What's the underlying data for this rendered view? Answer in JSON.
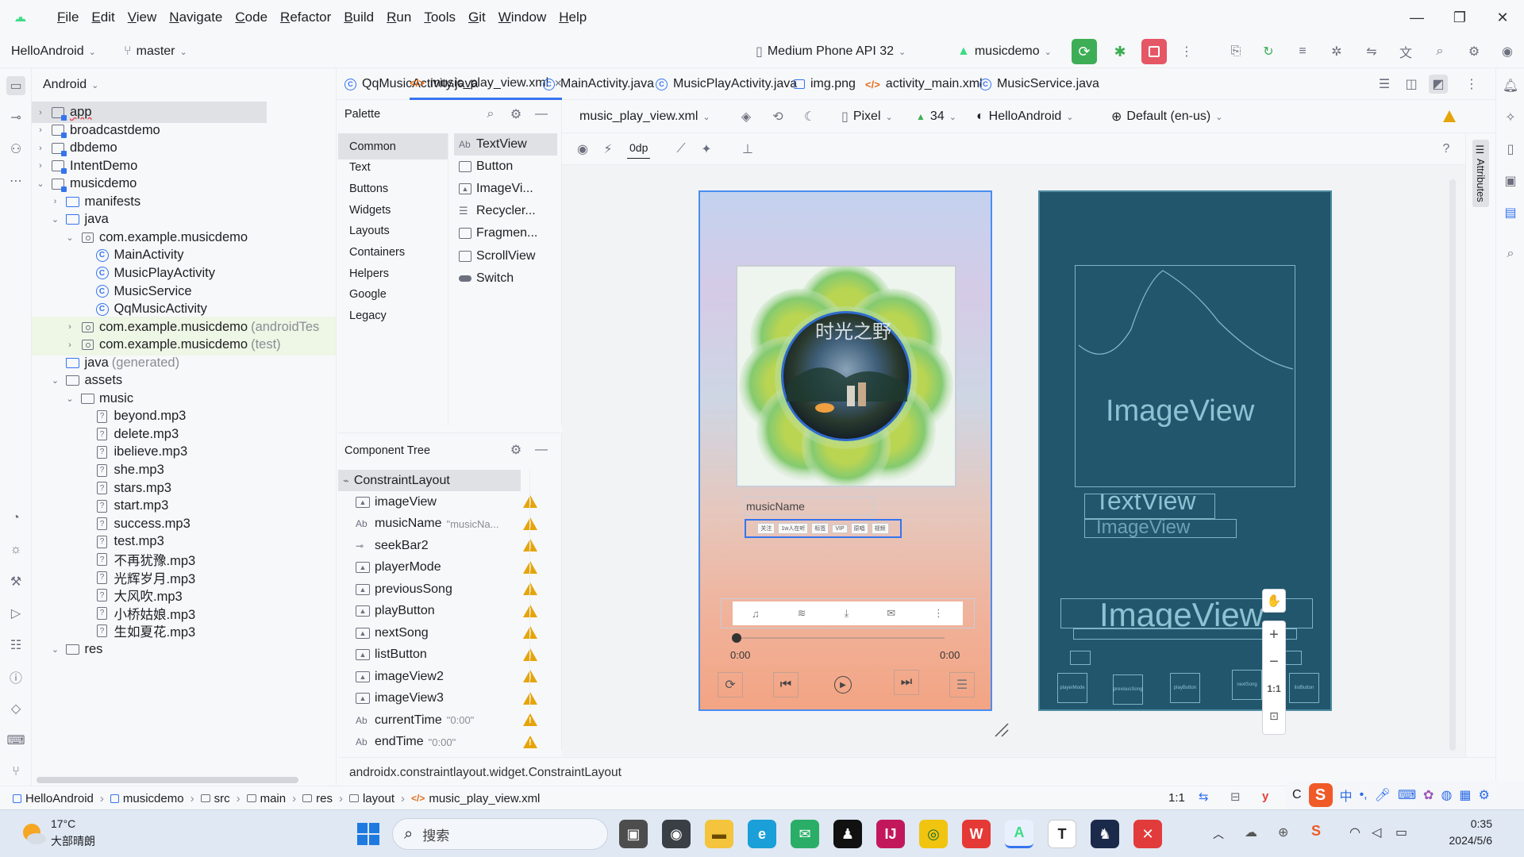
{
  "menu": {
    "items": [
      "File",
      "Edit",
      "View",
      "Navigate",
      "Code",
      "Refactor",
      "Build",
      "Run",
      "Tools",
      "Git",
      "Window",
      "Help"
    ],
    "mnemonics": [
      "F",
      "E",
      "V",
      "N",
      "C",
      "R",
      "B",
      "R",
      "T",
      "G",
      "W",
      "H"
    ]
  },
  "toolbar": {
    "project": "HelloAndroid",
    "branch": "master",
    "device": "Medium Phone API 32",
    "run_config": "musicdemo"
  },
  "project_panel": {
    "view_label": "Android",
    "rows": [
      {
        "label": "app",
        "icon": "module",
        "indent": 0,
        "arrow": "›",
        "underline": true
      },
      {
        "label": "broadcastdemo",
        "icon": "module",
        "indent": 0,
        "arrow": "›"
      },
      {
        "label": "dbdemo",
        "icon": "module",
        "indent": 0,
        "arrow": "›"
      },
      {
        "label": "IntentDemo",
        "icon": "module",
        "indent": 0,
        "arrow": "›"
      },
      {
        "label": "musicdemo",
        "icon": "module",
        "indent": 0,
        "arrow": "⌄"
      },
      {
        "label": "manifests",
        "icon": "folder-blue",
        "indent": 1,
        "arrow": "›"
      },
      {
        "label": "java",
        "icon": "folder-blue",
        "indent": 1,
        "arrow": "⌄"
      },
      {
        "label": "com.example.musicdemo",
        "icon": "package",
        "indent": 2,
        "arrow": "⌄"
      },
      {
        "label": "MainActivity",
        "icon": "class",
        "indent": 3,
        "arrow": ""
      },
      {
        "label": "MusicPlayActivity",
        "icon": "class",
        "indent": 3,
        "arrow": ""
      },
      {
        "label": "MusicService",
        "icon": "class",
        "indent": 3,
        "arrow": ""
      },
      {
        "label": "QqMusicActivity",
        "icon": "class",
        "indent": 3,
        "arrow": ""
      },
      {
        "label": "com.example.musicdemo",
        "icon": "package",
        "indent": 2,
        "arrow": "›",
        "suffix": "(androidTes",
        "green": true
      },
      {
        "label": "com.example.musicdemo",
        "icon": "package",
        "indent": 2,
        "arrow": "›",
        "suffix": "(test)",
        "green": true
      },
      {
        "label": "java",
        "icon": "folder-blue",
        "indent": 1,
        "arrow": "",
        "suffix": "(generated)"
      },
      {
        "label": "assets",
        "icon": "folder",
        "indent": 1,
        "arrow": "⌄"
      },
      {
        "label": "music",
        "icon": "folder",
        "indent": 2,
        "arrow": "⌄"
      },
      {
        "label": "beyond.mp3",
        "icon": "file",
        "indent": 3,
        "arrow": ""
      },
      {
        "label": "delete.mp3",
        "icon": "file",
        "indent": 3,
        "arrow": ""
      },
      {
        "label": "ibelieve.mp3",
        "icon": "file",
        "indent": 3,
        "arrow": ""
      },
      {
        "label": "she.mp3",
        "icon": "file",
        "indent": 3,
        "arrow": ""
      },
      {
        "label": "stars.mp3",
        "icon": "file",
        "indent": 3,
        "arrow": ""
      },
      {
        "label": "start.mp3",
        "icon": "file",
        "indent": 3,
        "arrow": ""
      },
      {
        "label": "success.mp3",
        "icon": "file",
        "indent": 3,
        "arrow": ""
      },
      {
        "label": "test.mp3",
        "icon": "file",
        "indent": 3,
        "arrow": ""
      },
      {
        "label": "不再犹豫.mp3",
        "icon": "file",
        "indent": 3,
        "arrow": ""
      },
      {
        "label": "光辉岁月.mp3",
        "icon": "file",
        "indent": 3,
        "arrow": ""
      },
      {
        "label": "大风吹.mp3",
        "icon": "file",
        "indent": 3,
        "arrow": ""
      },
      {
        "label": "小桥姑娘.mp3",
        "icon": "file",
        "indent": 3,
        "arrow": ""
      },
      {
        "label": "生如夏花.mp3",
        "icon": "file",
        "indent": 3,
        "arrow": ""
      },
      {
        "label": "res",
        "icon": "folder",
        "indent": 1,
        "arrow": "⌄"
      }
    ]
  },
  "tabs": [
    {
      "label": "QqMusicActivity.java",
      "type": "class"
    },
    {
      "label": "music_play_view.xml",
      "type": "xml",
      "active": true
    },
    {
      "label": "MainActivity.java",
      "type": "class"
    },
    {
      "label": "MusicPlayActivity.java",
      "type": "class"
    },
    {
      "label": "img.png",
      "type": "image"
    },
    {
      "label": "activity_main.xml",
      "type": "xml"
    },
    {
      "label": "MusicService.java",
      "type": "class"
    }
  ],
  "palette": {
    "title": "Palette",
    "categories": [
      "Common",
      "Text",
      "Buttons",
      "Widgets",
      "Layouts",
      "Containers",
      "Helpers",
      "Google",
      "Legacy"
    ],
    "items": [
      {
        "label": "TextView",
        "icon": "Ab"
      },
      {
        "label": "Button",
        "icon": ""
      },
      {
        "label": "ImageVi...",
        "icon": "img"
      },
      {
        "label": "Recycler...",
        "icon": "list"
      },
      {
        "label": "Fragmen...",
        "icon": ""
      },
      {
        "label": "ScrollView",
        "icon": ""
      },
      {
        "label": "Switch",
        "icon": "switch"
      }
    ]
  },
  "component_tree": {
    "title": "Component Tree",
    "root": "ConstraintLayout",
    "items": [
      {
        "label": "imageView",
        "icon": "img",
        "hint": ""
      },
      {
        "label": "musicName",
        "icon": "Ab",
        "hint": "\"musicNa..."
      },
      {
        "label": "seekBar2",
        "icon": "seek",
        "hint": ""
      },
      {
        "label": "playerMode",
        "icon": "img",
        "hint": ""
      },
      {
        "label": "previousSong",
        "icon": "img",
        "hint": ""
      },
      {
        "label": "playButton",
        "icon": "img",
        "hint": ""
      },
      {
        "label": "nextSong",
        "icon": "img",
        "hint": ""
      },
      {
        "label": "listButton",
        "icon": "img",
        "hint": ""
      },
      {
        "label": "imageView2",
        "icon": "img",
        "hint": ""
      },
      {
        "label": "imageView3",
        "icon": "img",
        "hint": ""
      },
      {
        "label": "currentTime",
        "icon": "Ab",
        "hint": "\"0:00\""
      },
      {
        "label": "endTime",
        "icon": "Ab",
        "hint": "\"0:00\""
      }
    ],
    "footer": "androidx.constraintlayout.widget.ConstraintLayout"
  },
  "design_toolbar": {
    "file": "music_play_view.xml",
    "device": "Pixel",
    "api": "34",
    "theme": "HelloAndroid",
    "locale": "Default (en-us)",
    "margin": "0dp"
  },
  "phone": {
    "music_name": "musicName",
    "tags": [
      "关注",
      "1w人在听",
      "标签",
      "VIP",
      "原唱",
      "视频"
    ],
    "current_time": "0:00",
    "end_time": "0:00",
    "album_title": "时光之野"
  },
  "blueprint": {
    "image_label_1": "ImageView",
    "text_label": "TextView",
    "image_label_2": "ImageView",
    "image_label_3": "ImageView",
    "buttons": [
      "playerMode",
      "previousSong",
      "playButton",
      "nextSong",
      "listButton"
    ]
  },
  "zoom": {
    "ratio": "1:1"
  },
  "statusbar": {
    "crumbs": [
      "HelloAndroid",
      "musicdemo",
      "src",
      "main",
      "res",
      "layout",
      "music_play_view.xml"
    ],
    "ratio": "1:1"
  },
  "taskbar": {
    "weather_temp": "17°C",
    "weather_desc": "大部晴朗",
    "search": "搜索",
    "time": "0:35",
    "date": "2024/5/6",
    "ime": "中"
  },
  "colors": {
    "accent": "#3574f0",
    "warning": "#e5a50a",
    "blueprint": "#22566d"
  }
}
